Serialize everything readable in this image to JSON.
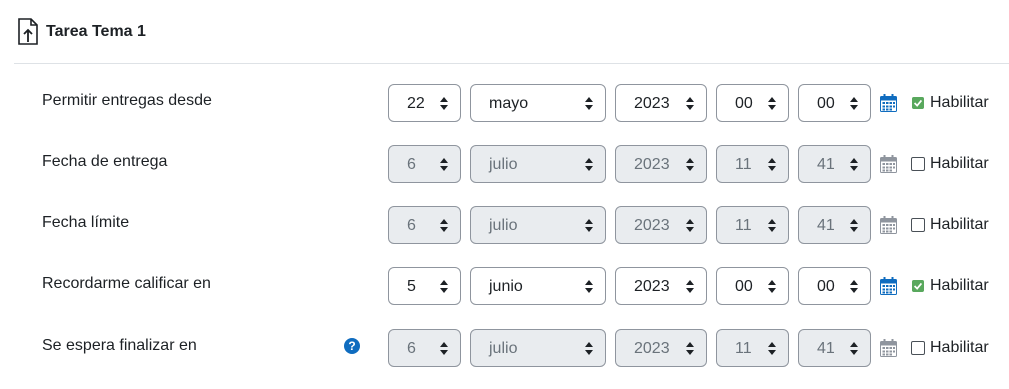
{
  "header": {
    "title": "Tarea Tema 1",
    "icon": "assignment-upload-icon"
  },
  "colors": {
    "accent": "#0f6cbf",
    "check": "#59a85d",
    "disabled_bg": "#e9ecef",
    "calendar_disabled": "#8f959e"
  },
  "rows": [
    {
      "label": "Permitir entregas desde",
      "day": "22",
      "month": "mayo",
      "year": "2023",
      "hour": "00",
      "minute": "00",
      "enabled": true,
      "enable_label": "Habilitar",
      "help": false
    },
    {
      "label": "Fecha de entrega",
      "day": "6",
      "month": "julio",
      "year": "2023",
      "hour": "11",
      "minute": "41",
      "enabled": false,
      "enable_label": "Habilitar",
      "help": false
    },
    {
      "label": "Fecha límite",
      "day": "6",
      "month": "julio",
      "year": "2023",
      "hour": "11",
      "minute": "41",
      "enabled": false,
      "enable_label": "Habilitar",
      "help": false
    },
    {
      "label": "Recordarme calificar en",
      "day": "5",
      "month": "junio",
      "year": "2023",
      "hour": "00",
      "minute": "00",
      "enabled": true,
      "enable_label": "Habilitar",
      "help": false
    },
    {
      "label": "Se espera finalizar en",
      "day": "6",
      "month": "julio",
      "year": "2023",
      "hour": "11",
      "minute": "41",
      "enabled": false,
      "enable_label": "Habilitar",
      "help": true,
      "help_glyph": "?"
    }
  ]
}
